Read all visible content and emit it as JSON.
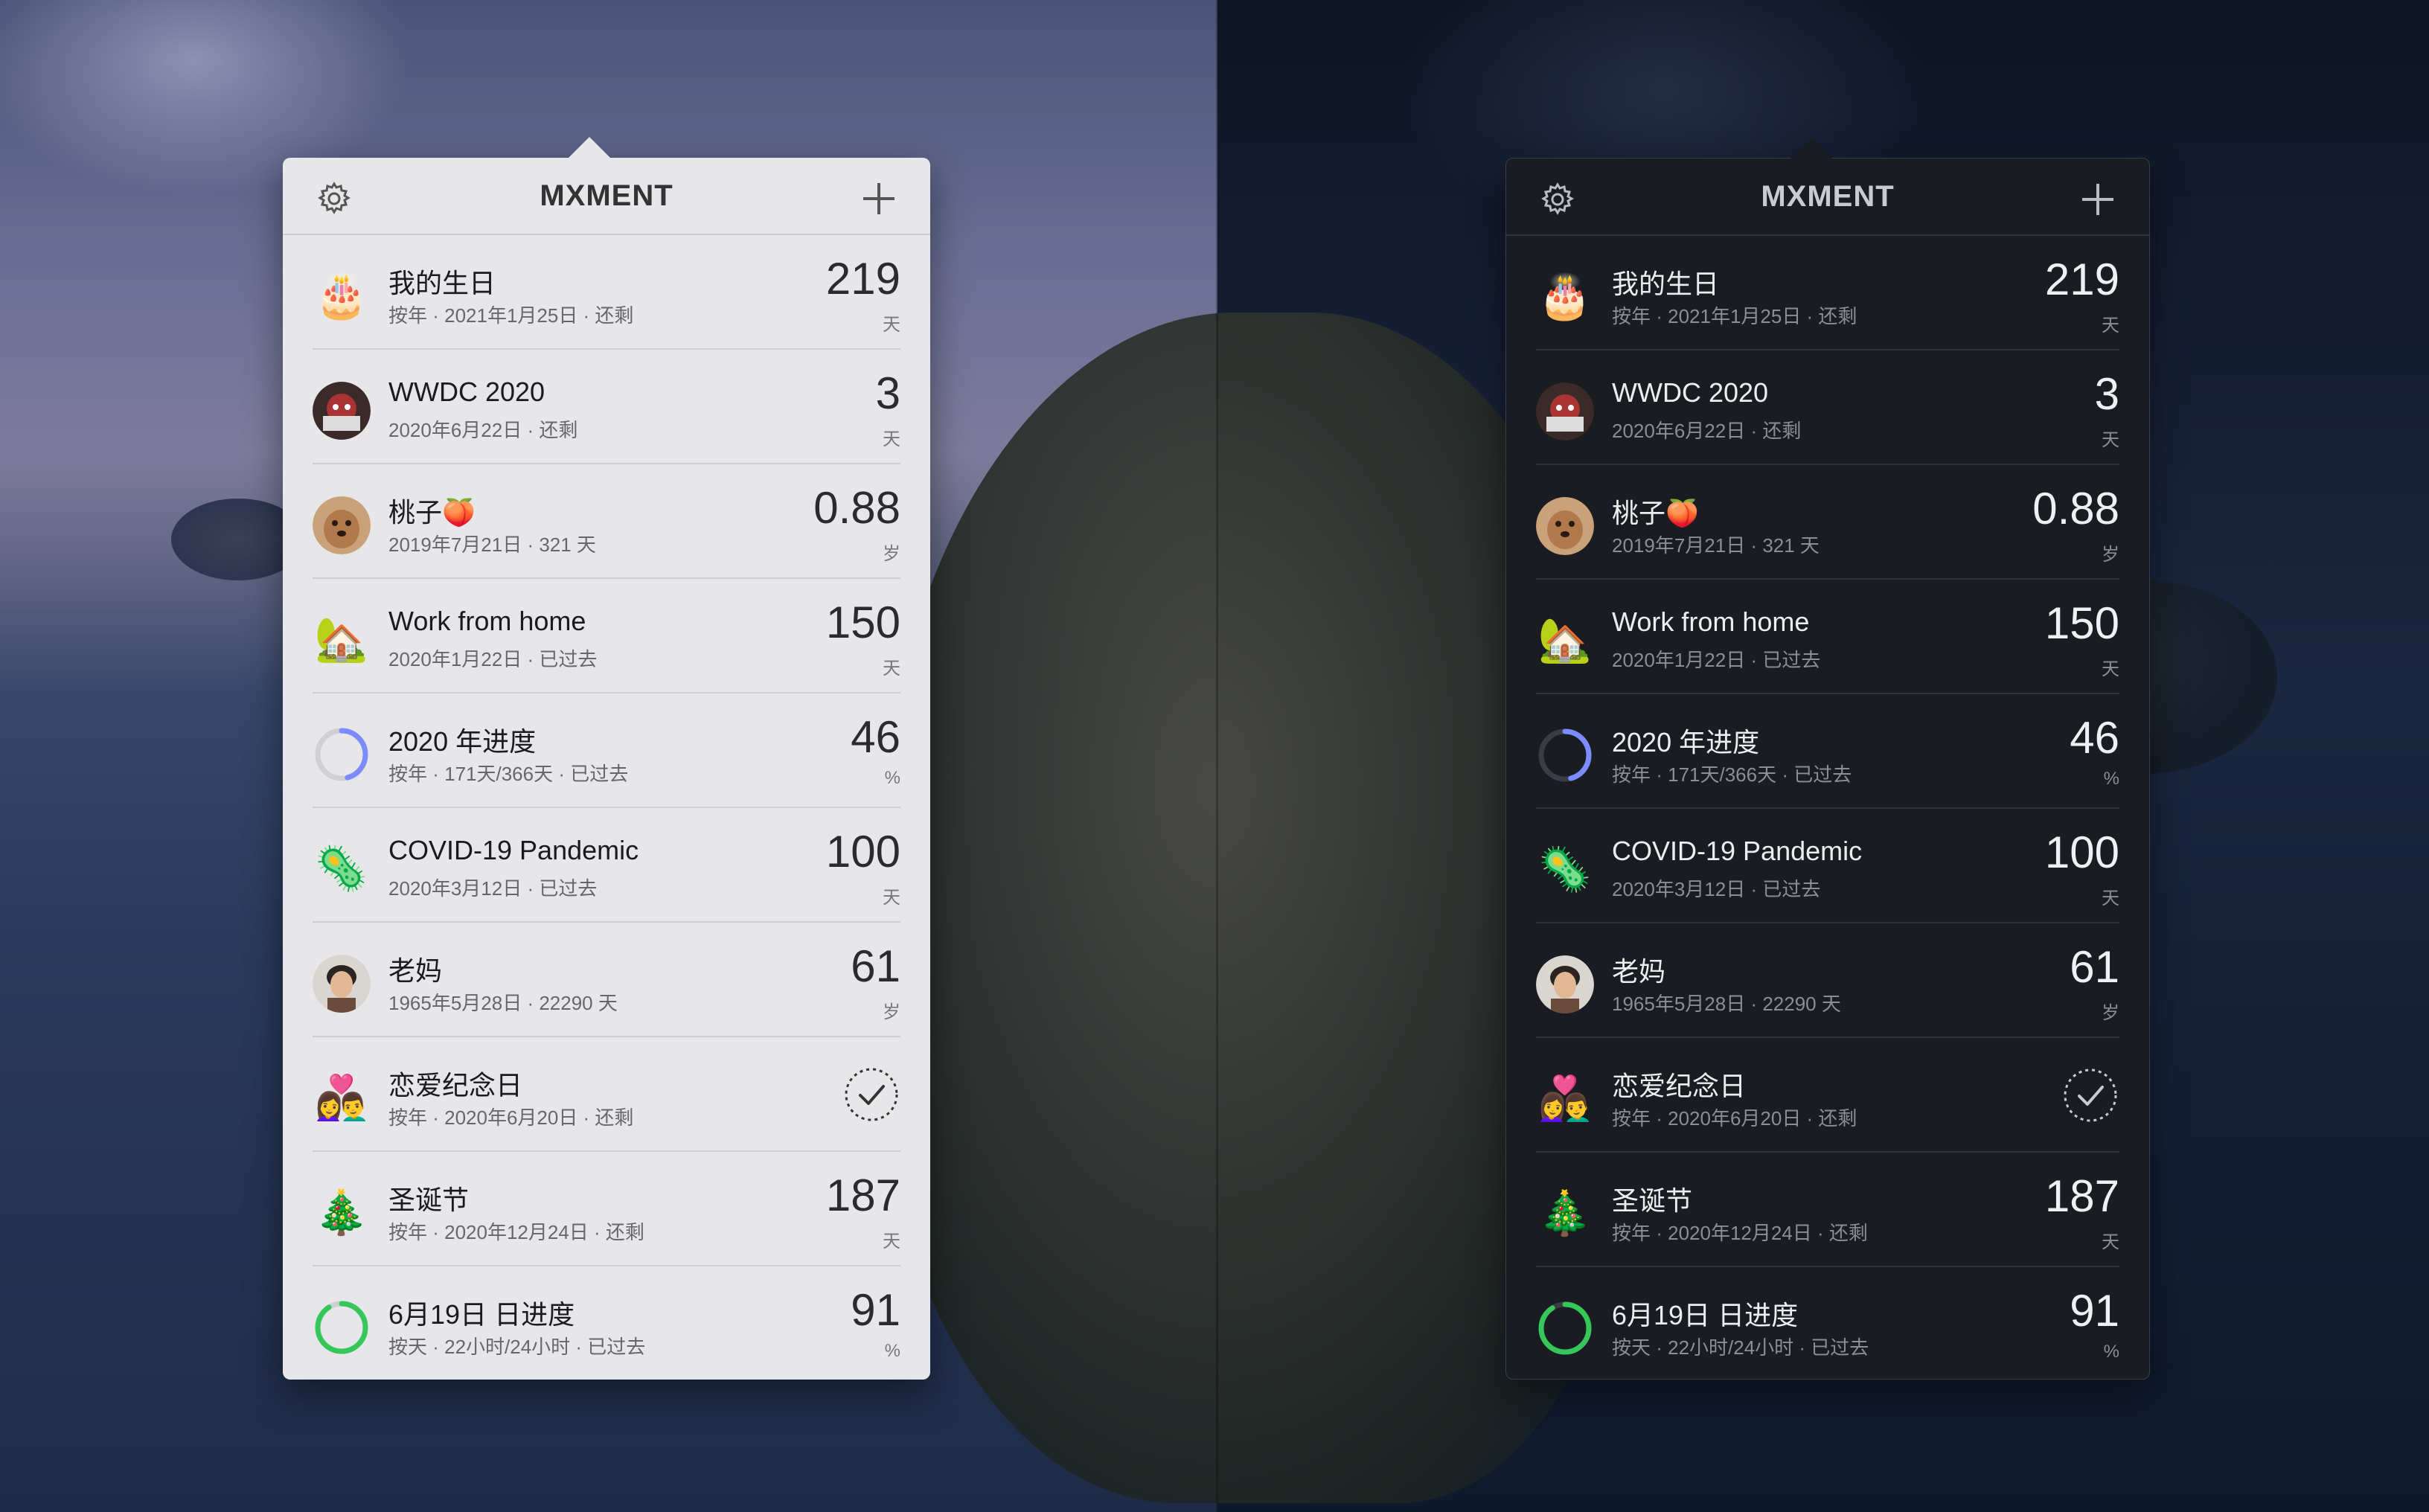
{
  "app": {
    "brand": "MXMENT"
  },
  "icons": {
    "settings": "gear-icon",
    "add": "plus-icon",
    "completed": "check-circle-icon"
  },
  "colors": {
    "light_panel": "#e7e7e9",
    "dark_panel": "#1a1c22",
    "progress_blue": "#7c8cff",
    "progress_green": "#35c759"
  },
  "items": [
    {
      "icon": "🎂",
      "title": "我的生日",
      "sub": "按年 · 2021年1月25日 · 还剩",
      "value": "219",
      "unit": "天"
    },
    {
      "icon": "wwdc-avatar",
      "title": "WWDC 2020",
      "sub": "2020年6月22日 · 还剩",
      "value": "3",
      "unit": "天"
    },
    {
      "icon": "dog-avatar",
      "title": "桃子🍑",
      "sub": "2019年7月21日 · 321 天",
      "value": "0.88",
      "unit": "岁"
    },
    {
      "icon": "🏡",
      "title": "Work from home",
      "sub": "2020年1月22日 · 已过去",
      "value": "150",
      "unit": "天"
    },
    {
      "icon": "progress-ring",
      "progress": 0.46,
      "title": "2020 年进度",
      "sub": "按年 · 171天/366天 · 已过去",
      "value": "46",
      "unit": "%"
    },
    {
      "icon": "🦠",
      "title": "COVID-19 Pandemic",
      "sub": "2020年3月12日 · 已过去",
      "value": "100",
      "unit": "天"
    },
    {
      "icon": "mom-avatar",
      "title": "老妈",
      "sub": "1965年5月28日 · 22290 天",
      "value": "61",
      "unit": "岁"
    },
    {
      "icon": "👩‍❤️‍👨",
      "title": "恋爱纪念日",
      "sub": "按年 · 2020年6月20日 · 还剩",
      "value": "",
      "unit": ""
    },
    {
      "icon": "🎄",
      "title": "圣诞节",
      "sub": "按年 · 2020年12月24日 · 还剩",
      "value": "187",
      "unit": "天"
    },
    {
      "icon": "progress-ring",
      "progress": 0.91,
      "title": "6月19日 日进度",
      "sub": "按天 · 22小时/24小时 · 已过去",
      "value": "91",
      "unit": "%"
    }
  ]
}
